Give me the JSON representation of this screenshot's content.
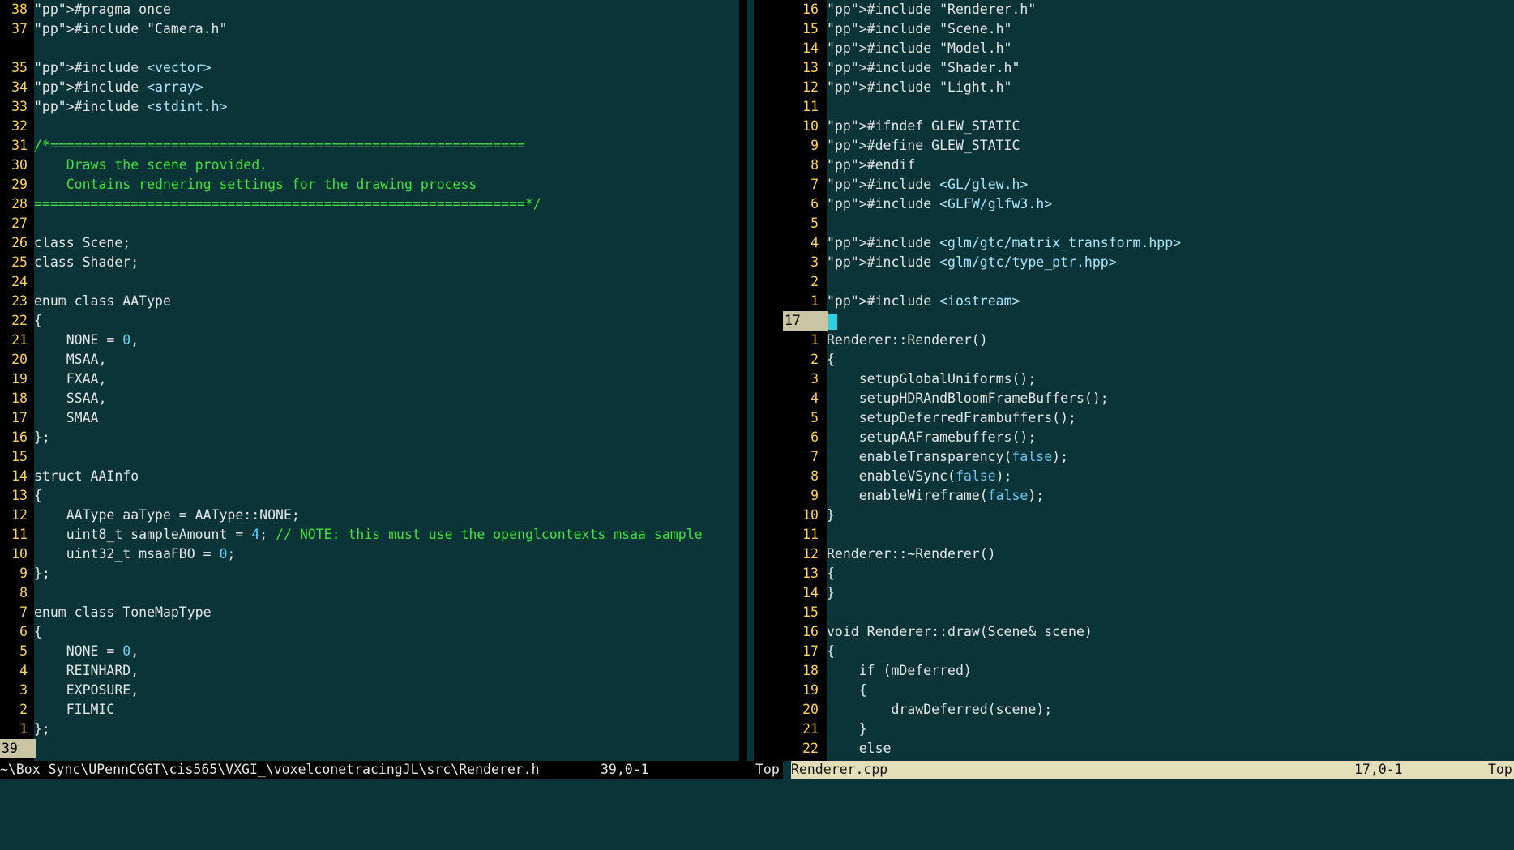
{
  "left": {
    "lines": [
      {
        "n": "38",
        "c": "#pragma once"
      },
      {
        "n": "37",
        "c": "#include \"Camera.h\""
      },
      {
        "n": "",
        "c": ""
      },
      {
        "n": "35",
        "c": "#include <vector>"
      },
      {
        "n": "34",
        "c": "#include <array>"
      },
      {
        "n": "33",
        "c": "#include <stdint.h>"
      },
      {
        "n": "32",
        "c": ""
      },
      {
        "n": "31",
        "c": "/*==========================================================="
      },
      {
        "n": "30",
        "c": "    Draws the scene provided."
      },
      {
        "n": "29",
        "c": "    Contains rednering settings for the drawing process"
      },
      {
        "n": "28",
        "c": "=============================================================*/"
      },
      {
        "n": "27",
        "c": ""
      },
      {
        "n": "26",
        "c": "class Scene;"
      },
      {
        "n": "25",
        "c": "class Shader;"
      },
      {
        "n": "24",
        "c": ""
      },
      {
        "n": "23",
        "c": "enum class AAType"
      },
      {
        "n": "22",
        "c": "{"
      },
      {
        "n": "21",
        "c": "    NONE = 0,"
      },
      {
        "n": "20",
        "c": "    MSAA,"
      },
      {
        "n": "19",
        "c": "    FXAA,"
      },
      {
        "n": "18",
        "c": "    SSAA,"
      },
      {
        "n": "17",
        "c": "    SMAA"
      },
      {
        "n": "16",
        "c": "};"
      },
      {
        "n": "15",
        "c": ""
      },
      {
        "n": "14",
        "c": "struct AAInfo"
      },
      {
        "n": "13",
        "c": "{"
      },
      {
        "n": "12",
        "c": "    AAType aaType = AAType::NONE;"
      },
      {
        "n": "11",
        "c": "    uint8_t sampleAmount = 4; // NOTE: this must use the openglcontexts msaa sample"
      },
      {
        "n": "10",
        "c": "    uint32_t msaaFBO = 0;"
      },
      {
        "n": "9",
        "c": "};"
      },
      {
        "n": "8",
        "c": ""
      },
      {
        "n": "7",
        "c": "enum class ToneMapType"
      },
      {
        "n": "6",
        "c": "{"
      },
      {
        "n": "5",
        "c": "    NONE = 0,"
      },
      {
        "n": "4",
        "c": "    REINHARD,"
      },
      {
        "n": "3",
        "c": "    EXPOSURE,"
      },
      {
        "n": "2",
        "c": "    FILMIC"
      },
      {
        "n": "1",
        "c": "};"
      },
      {
        "n": "39",
        "c": ""
      }
    ],
    "status": {
      "file": "~\\Box Sync\\UPennCGGT\\cis565\\VXGI_\\voxelconetracingJL\\src\\Renderer.h",
      "pos": "39,0-1",
      "scroll": "Top"
    }
  },
  "right": {
    "lines": [
      {
        "n": "16",
        "c": "#include \"Renderer.h\""
      },
      {
        "n": "15",
        "c": "#include \"Scene.h\""
      },
      {
        "n": "14",
        "c": "#include \"Model.h\""
      },
      {
        "n": "13",
        "c": "#include \"Shader.h\""
      },
      {
        "n": "12",
        "c": "#include \"Light.h\""
      },
      {
        "n": "11",
        "c": ""
      },
      {
        "n": "10",
        "c": "#ifndef GLEW_STATIC"
      },
      {
        "n": "9",
        "c": "#define GLEW_STATIC"
      },
      {
        "n": "8",
        "c": "#endif"
      },
      {
        "n": "7",
        "c": "#include <GL/glew.h>"
      },
      {
        "n": "6",
        "c": "#include <GLFW/glfw3.h>"
      },
      {
        "n": "5",
        "c": ""
      },
      {
        "n": "4",
        "c": "#include <glm/gtc/matrix_transform.hpp>"
      },
      {
        "n": "3",
        "c": "#include <glm/gtc/type_ptr.hpp>"
      },
      {
        "n": "2",
        "c": ""
      },
      {
        "n": "1",
        "c": "#include <iostream>"
      },
      {
        "n": "17",
        "c": ""
      },
      {
        "n": "1",
        "c": "Renderer::Renderer()"
      },
      {
        "n": "2",
        "c": "{"
      },
      {
        "n": "3",
        "c": "    setupGlobalUniforms();"
      },
      {
        "n": "4",
        "c": "    setupHDRAndBloomFrameBuffers();"
      },
      {
        "n": "5",
        "c": "    setupDeferredFrambuffers();"
      },
      {
        "n": "6",
        "c": "    setupAAFramebuffers();"
      },
      {
        "n": "7",
        "c": "    enableTransparency(false);"
      },
      {
        "n": "8",
        "c": "    enableVSync(false);"
      },
      {
        "n": "9",
        "c": "    enableWireframe(false);"
      },
      {
        "n": "10",
        "c": "}"
      },
      {
        "n": "11",
        "c": ""
      },
      {
        "n": "12",
        "c": "Renderer::~Renderer()"
      },
      {
        "n": "13",
        "c": "{"
      },
      {
        "n": "14",
        "c": "}"
      },
      {
        "n": "15",
        "c": ""
      },
      {
        "n": "16",
        "c": "void Renderer::draw(Scene& scene)"
      },
      {
        "n": "17",
        "c": "{"
      },
      {
        "n": "18",
        "c": "    if (mDeferred)"
      },
      {
        "n": "19",
        "c": "    {"
      },
      {
        "n": "20",
        "c": "        drawDeferred(scene);"
      },
      {
        "n": "21",
        "c": "    }"
      },
      {
        "n": "22",
        "c": "    else"
      }
    ],
    "status": {
      "file": "Renderer.cpp",
      "pos": "17,0-1",
      "scroll": "Top"
    }
  },
  "colors": {
    "background": "#0a3438",
    "line_number": "#ffd34d",
    "comment": "#3ee33e",
    "string": "#a8e8ff",
    "preprocessor": "#e0a0a0",
    "cursor": "#2ad1e0",
    "status_active": "#e4dfb8"
  }
}
